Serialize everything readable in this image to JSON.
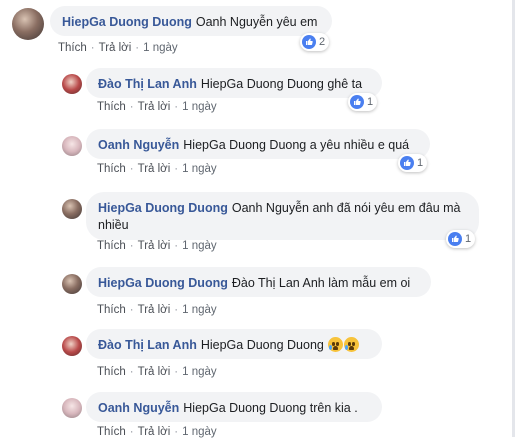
{
  "actions": {
    "like": "Thích",
    "reply": "Trả lời",
    "time": "1 ngày"
  },
  "colors": {
    "name": "#385898",
    "bubble": "#f2f3f5",
    "like": "#4a7ff0"
  },
  "comments": [
    {
      "name": "HiepGa Duong Duong",
      "text": "Oanh Nguyễn yêu em",
      "reactions": "2",
      "icon": "like-icon"
    },
    {
      "name": "Đào Thị Lan Anh",
      "text": "HiepGa Duong Duong ghê ta",
      "reactions": "1",
      "icon": "like-icon"
    },
    {
      "name": "Oanh Nguyễn",
      "text": "HiepGa Duong Duong a yêu nhiều e quá",
      "reactions": "1",
      "icon": "like-icon"
    },
    {
      "name": "HiepGa Duong Duong",
      "text": "Oanh Nguyễn anh đã nói yêu em đâu mà nhiều",
      "reactions": "1",
      "icon": "like-icon"
    },
    {
      "name": "HiepGa Duong Duong",
      "text": "Đào Thị Lan Anh làm mẫu em oi"
    },
    {
      "name": "Đào Thị Lan Anh",
      "text": "HiepGa Duong Duong",
      "emojis": [
        "crying-emoji",
        "crying-emoji"
      ]
    },
    {
      "name": "Oanh Nguyễn",
      "text": "HiepGa Duong Duong trên kia ."
    }
  ]
}
